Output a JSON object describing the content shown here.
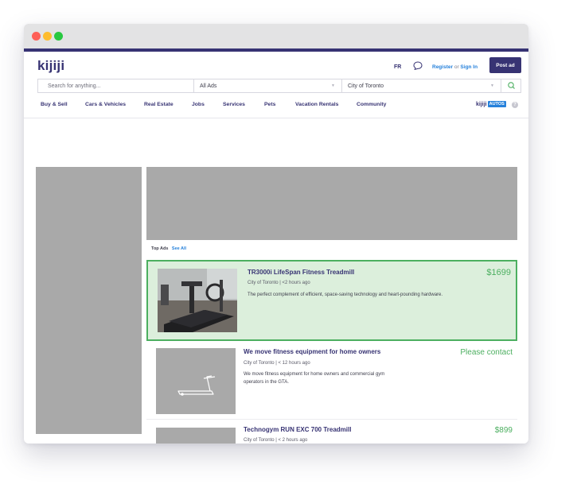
{
  "header": {
    "logo": "kijiji",
    "lang": "FR",
    "register": "Register",
    "or": "or",
    "sign_in": "Sign In",
    "post_ad": "Post ad"
  },
  "search": {
    "placeholder": "Search for anything...",
    "category": "All Ads",
    "location": "City of Toronto"
  },
  "nav": {
    "items": [
      "Buy & Sell",
      "Cars & Vehicles",
      "Real Estate",
      "Jobs",
      "Services",
      "Pets",
      "Vacation Rentals",
      "Community"
    ],
    "kijiji_autos_k": "kijiji",
    "kijiji_autos_a": "AUTOS",
    "help": "?"
  },
  "top_ads": {
    "label": "Top Ads",
    "see_all": "See All"
  },
  "listings": [
    {
      "title": "TR3000i LifeSpan Fitness Treadmill",
      "meta": "City of Toronto | <2 hours ago",
      "desc": "The perfect complement of efficient, space-saving technology and heart-pounding hardware.",
      "price": "$1699"
    },
    {
      "title": "We move fitness equipment for home owners",
      "meta": "City of Toronto | < 12 hours ago",
      "desc": "We move fitness equipment for home owners and commercial gym operators in the GTA.",
      "price": "Please contact"
    },
    {
      "title": "Technogym RUN EXC 700 Treadmill",
      "meta": "City of Toronto | < 2 hours ago",
      "desc": "",
      "price": "$899"
    }
  ],
  "colors": {
    "brand": "#373373",
    "link": "#2681db",
    "price": "#4caf60",
    "featured_bg": "#dcefdc"
  }
}
